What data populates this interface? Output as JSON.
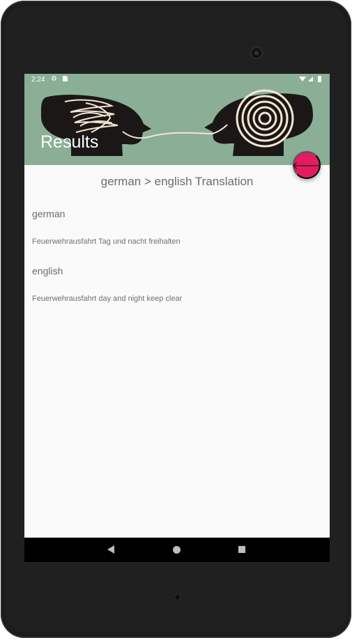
{
  "status_bar": {
    "time": "2:24",
    "settings_icon": "gear-icon",
    "sd_icon": "sd-card-icon",
    "wifi_icon": "wifi-icon",
    "signal_icon": "signal-icon",
    "battery_icon": "battery-icon"
  },
  "header": {
    "title": "Results",
    "background_color": "#8aaf96",
    "fab_icon": "arrow-left-icon",
    "fab_color": "#e31c5f",
    "fab_glyph": "🡐"
  },
  "main": {
    "translation_title": "german > english Translation",
    "source": {
      "label": "german",
      "text": "Feuerwehrausfahrt Tag und nacht freihalten"
    },
    "target": {
      "label": "english",
      "text": "Feuerwehrausfahrt day and night keep clear"
    }
  },
  "navigation": {
    "back_icon": "back-triangle-icon",
    "home_icon": "home-circle-icon",
    "recents_icon": "recents-square-icon"
  }
}
